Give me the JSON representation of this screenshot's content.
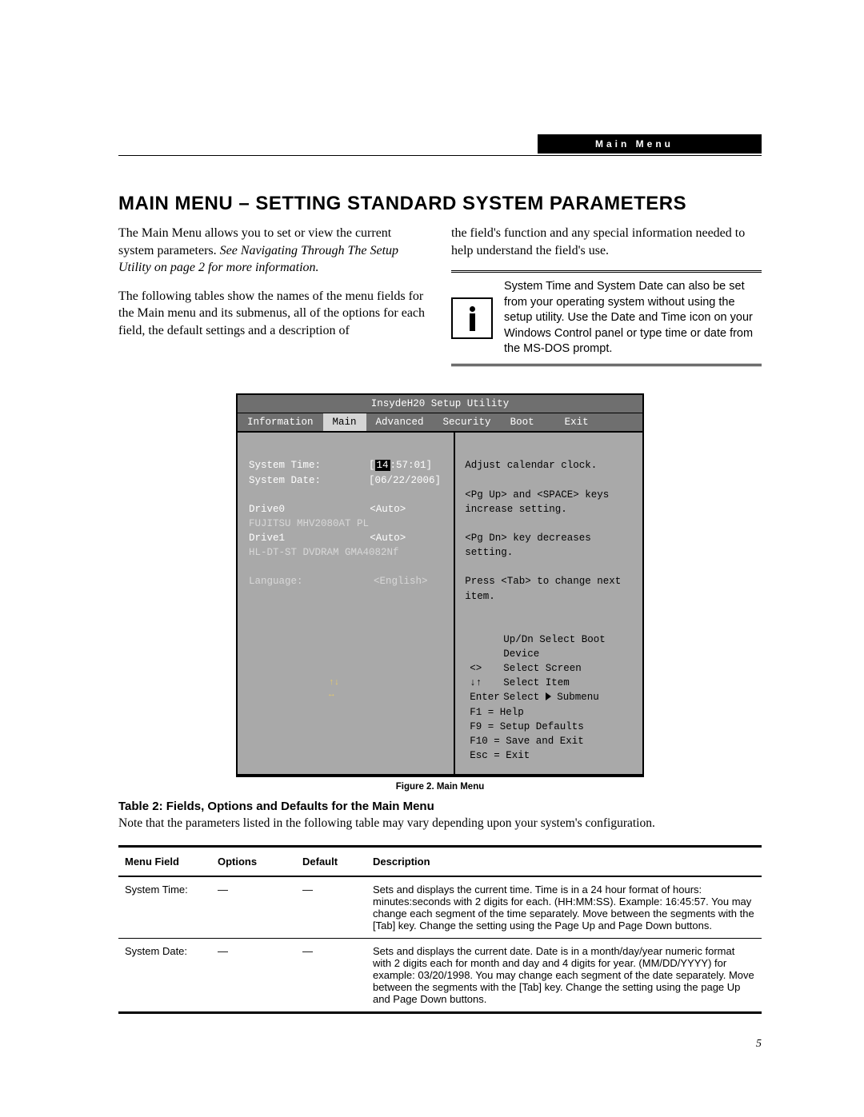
{
  "header": {
    "section": "Main Menu"
  },
  "title": "MAIN MENU – SETTING STANDARD SYSTEM PARAMETERS",
  "body": {
    "p1a": "The Main Menu allows you to set or view the current system parameters. ",
    "p1b": "See Navigating Through The Setup Utility on page 2 for more information.",
    "p2": "The following tables show the names of the menu fields for the Main menu and its submenus, all of the options for each field, the default settings and a description of",
    "p3": "the field's function and any special information needed to help understand the field's use.",
    "info": "System Time and System Date can also be set from your operating system without using the setup utility. Use the Date and Time icon on your Windows Control panel or type time or date from the MS-DOS prompt."
  },
  "bios": {
    "title": "InsydeH20 Setup Utility",
    "tabs": [
      "Information",
      "Main",
      "Advanced",
      "Security",
      "Boot",
      "Exit"
    ],
    "active_tab": "Main",
    "left": {
      "time_lbl": "System Time:",
      "time_hh": "14",
      "time_rest": ":57:01]",
      "date_lbl": "System Date:",
      "date_val": "[06/22/2006]",
      "drive0_lbl": "Drive0",
      "drive0_val": "<Auto>",
      "drive0_dev": "FUJITSU MHV2080AT PL",
      "drive1_lbl": "Drive1",
      "drive1_val": "<Auto>",
      "drive1_dev": "HL-DT-ST DVDRAM GMA4082Nf",
      "lang_lbl": "Language:",
      "lang_val": "<English>"
    },
    "right": {
      "l1": "Adjust calendar clock.",
      "l2": "<Pg Up> and <SPACE> keys increase setting.",
      "l3": "<Pg Dn> key decreases setting.",
      "l4": "Press <Tab> to change next item.",
      "nav1": "Up/Dn Select Boot Device",
      "nav2a": "<>",
      "nav2b": "Select Screen",
      "nav3a": "↓↑",
      "nav3b": "Select Item",
      "nav4a": "Enter",
      "nav4b": "Select",
      "nav4c": "Submenu",
      "nav5": "F1  =  Help",
      "nav6": "F9  =  Setup Defaults",
      "nav7": "F10 =  Save and Exit",
      "nav8": "Esc =  Exit"
    }
  },
  "fig_caption": "Figure 2.   Main Menu",
  "table_title": "Table 2: Fields, Options and Defaults for the Main Menu",
  "table_note": "Note that the parameters listed in the following table may vary depending upon your system's configuration.",
  "table": {
    "headers": [
      "Menu Field",
      "Options",
      "Default",
      "Description"
    ],
    "rows": [
      {
        "field": "System Time:",
        "options": "—",
        "default": "—",
        "desc": "Sets and displays the current time. Time is in a 24 hour format of hours: minutes:seconds with 2 digits for each. (HH:MM:SS). Example: 16:45:57. You may change each segment of the time separately. Move between the segments with the [Tab] key. Change the setting using the Page Up and Page Down buttons."
      },
      {
        "field": "System Date:",
        "options": "—",
        "default": "—",
        "desc": "Sets and displays the current date. Date is in a month/day/year numeric format with 2 digits each for month and day and 4 digits for year. (MM/DD/YYYY) for example: 03/20/1998. You may change each segment of the date separately. Move between the segments with the [Tab] key. Change the setting using the page Up and Page Down buttons."
      }
    ]
  },
  "page_number": "5"
}
